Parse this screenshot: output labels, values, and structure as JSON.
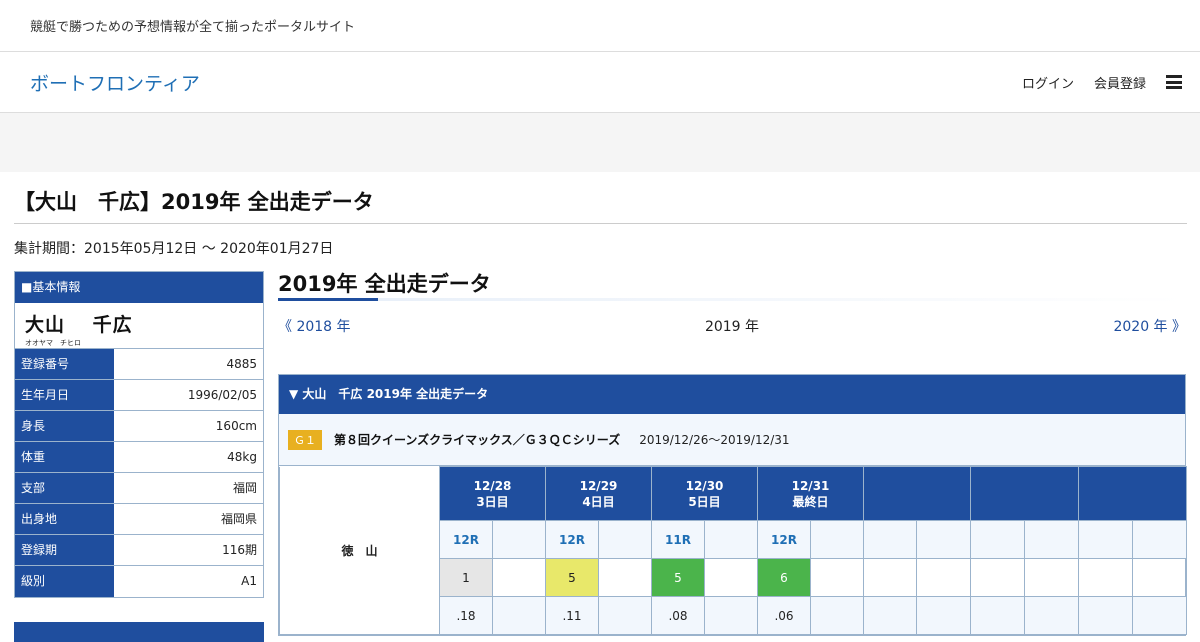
{
  "topbar": {
    "tagline": "競艇で勝つための予想情報が全て揃ったポータルサイト"
  },
  "header": {
    "logo": "ボートフロンティア",
    "login": "ログイン",
    "register": "会員登録",
    "menu_icon": "hamburger-icon"
  },
  "page": {
    "title": "【大山　千広】2019年 全出走データ",
    "period": "集計期間：2015年05月12日 ～ 2020年01月27日"
  },
  "info": {
    "head": "■基本情報",
    "name": "大山　 千広",
    "kana": "オオヤマ　チヒロ",
    "rows": [
      {
        "k": "登録番号",
        "v": "4885"
      },
      {
        "k": "生年月日",
        "v": "1996/02/05"
      },
      {
        "k": "身長",
        "v": "160cm"
      },
      {
        "k": "体重",
        "v": "48kg"
      },
      {
        "k": "支部",
        "v": "福岡"
      },
      {
        "k": "出身地",
        "v": "福岡県"
      },
      {
        "k": "登録期",
        "v": "116期"
      },
      {
        "k": "級別",
        "v": "A1"
      }
    ]
  },
  "section": {
    "title": "2019年 全出走データ",
    "prev": "《 2018 年",
    "current": "2019 年",
    "next": "2020 年 》"
  },
  "race": {
    "head": "▼ 大山　千広 2019年 全出走データ",
    "grade": "Ｇ１",
    "series_name": "第８回クイーンズクライマックス／Ｇ３ＱＣシリーズ",
    "series_date": "2019/12/26～2019/12/31",
    "venue": "徳　山",
    "days": [
      {
        "date": "12/28",
        "day": "3日目"
      },
      {
        "date": "12/29",
        "day": "4日目"
      },
      {
        "date": "12/30",
        "day": "5日目"
      },
      {
        "date": "12/31",
        "day": "最終日"
      }
    ],
    "races": [
      "12R",
      "12R",
      "11R",
      "12R"
    ],
    "positions": [
      "1",
      "5",
      "5",
      "6"
    ],
    "st": [
      ".18",
      ".11",
      ".08",
      ".06"
    ]
  },
  "colors": {
    "primary": "#1f4e9e",
    "link": "#1f6fb5",
    "grade": "#e8b020",
    "yellow": "#e8e86a",
    "green": "#4bb44b"
  }
}
